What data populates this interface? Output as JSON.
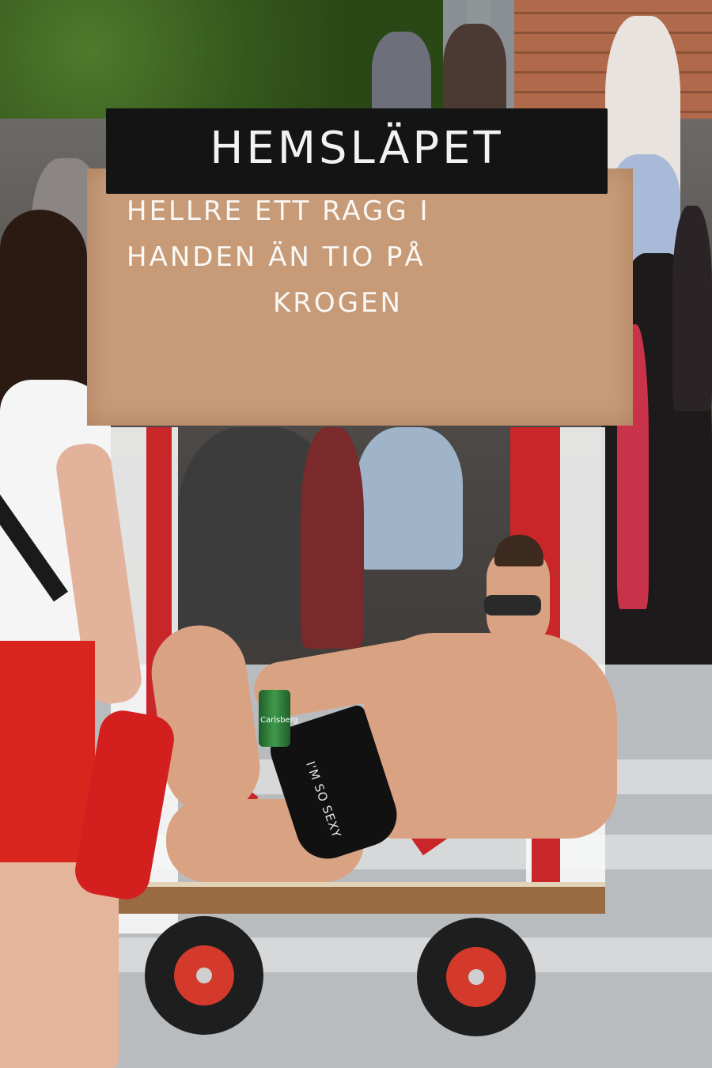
{
  "sign": {
    "title": "HEMSLÄPET",
    "lines": [
      "HELLRE ETT RAGG I",
      "HANDEN ÄN TIO PÅ",
      "KROGEN"
    ]
  },
  "apparel": {
    "briefs_print": "I'M SO SEXY",
    "can_label": "Carlsberg"
  },
  "colors": {
    "cart_red": "#c9262a",
    "sign_board": "#c79a78",
    "sign_header": "#141414"
  }
}
